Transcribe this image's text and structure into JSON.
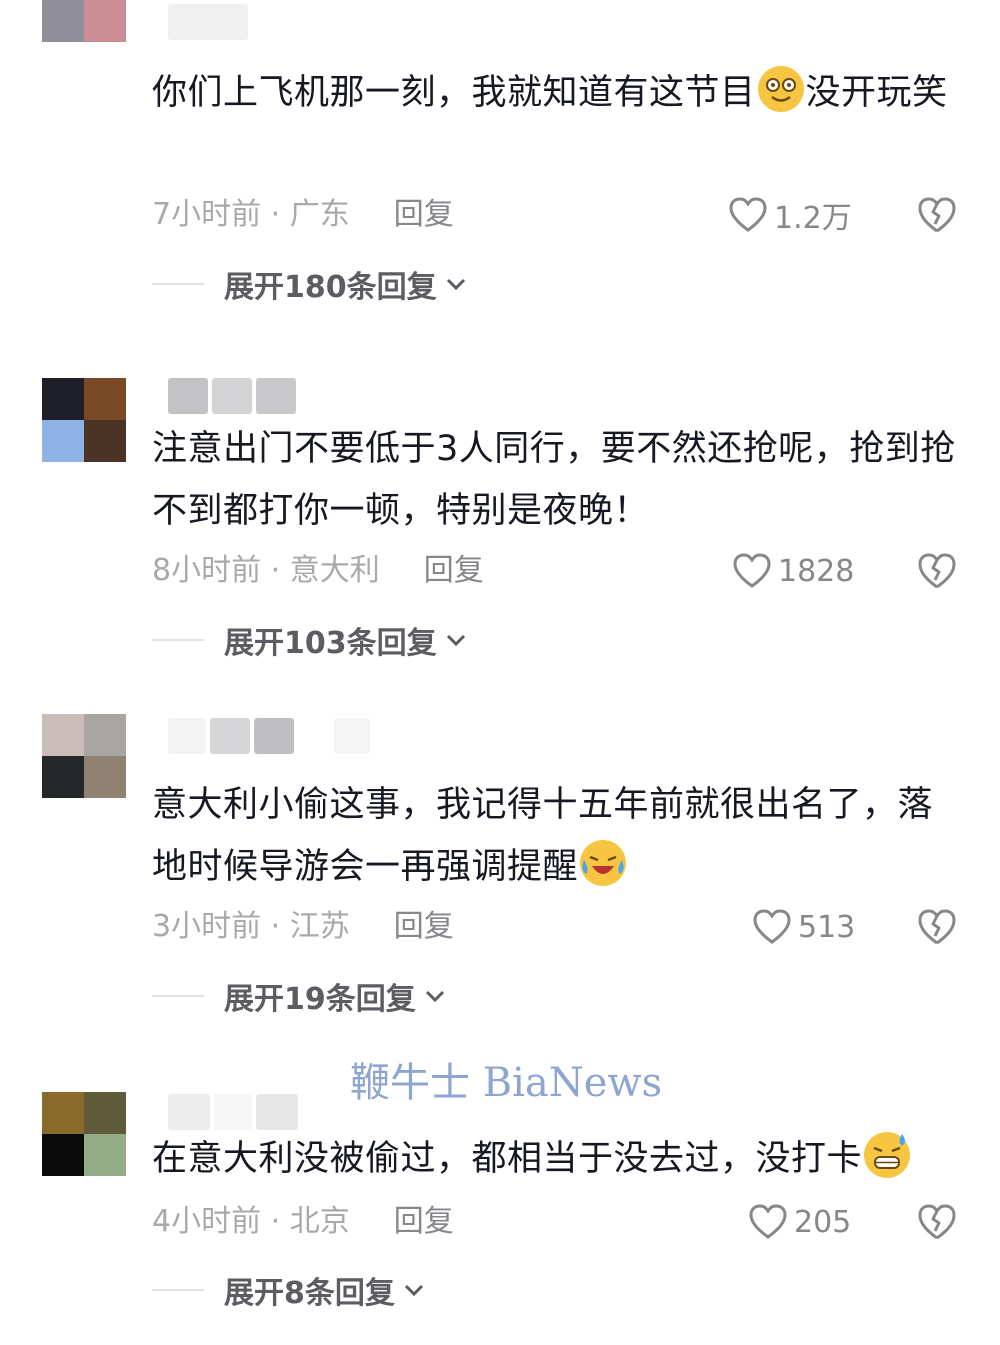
{
  "watermark": {
    "text": "鞭牛士 BiaNews"
  },
  "comments": [
    {
      "text_before_emoji": "你们上飞机那一刻，我就知道有这节目",
      "emoji_icon": "dizzy-smile-emoji",
      "text_after_emoji": "没开玩笑",
      "meta": "7小时前 · 广东",
      "reply_label": "回复",
      "likes": "1.2万",
      "expand_label": "展开180条回复",
      "avatar_colors": [
        "#d9cfc4",
        "#8a6a6e",
        "#8f8e99",
        "#c98d93"
      ]
    },
    {
      "text_before_emoji": "注意出门不要低于3人同行，要不然还抢呢，抢到抢不到都打你一顿，特别是夜晚！",
      "emoji_icon": "",
      "text_after_emoji": "",
      "meta": "8小时前 · 意大利",
      "reply_label": "回复",
      "likes": "1828",
      "expand_label": "展开103条回复",
      "avatar_colors": [
        "#1e1f29",
        "#7a4a26",
        "#8fb3e6",
        "#4b3426"
      ]
    },
    {
      "text_before_emoji": "意大利小偷这事，我记得十五年前就很出名了，落地时候导游会一再强调提醒",
      "emoji_icon": "crying-laughing-emoji",
      "text_after_emoji": "",
      "meta": "3小时前 · 江苏",
      "reply_label": "回复",
      "likes": "513",
      "expand_label": "展开19条回复",
      "avatar_colors": [
        "#c9bcb9",
        "#a9a5a3",
        "#252829",
        "#8f8273"
      ]
    },
    {
      "text_before_emoji": "在意大利没被偷过，都相当于没去过，没打卡",
      "emoji_icon": "sweat-grin-emoji",
      "text_after_emoji": "",
      "meta": "4小时前 · 北京",
      "reply_label": "回复",
      "likes": "205",
      "expand_label": "展开8条回复",
      "avatar_colors": [
        "#8a6a2a",
        "#5f5a3a",
        "#0b0b0b",
        "#94ad86"
      ]
    }
  ]
}
